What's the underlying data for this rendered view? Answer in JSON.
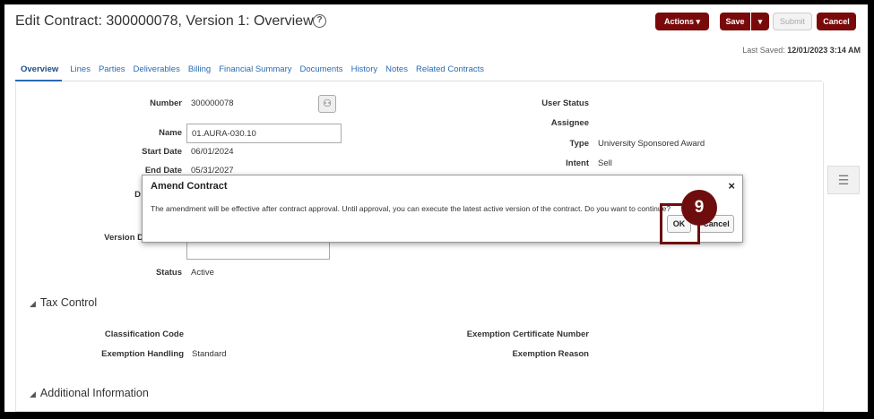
{
  "header": {
    "title": "Edit Contract: 300000078, Version 1: Overview",
    "help_icon": "?",
    "buttons": {
      "actions": "Actions ▾",
      "save": "Save",
      "save_menu": "▾",
      "submit": "Submit",
      "cancel": "Cancel"
    },
    "last_saved_label": "Last Saved:",
    "last_saved_value": "12/01/2023 3:14 AM"
  },
  "tabs": [
    "Overview",
    "Lines",
    "Parties",
    "Deliverables",
    "Billing",
    "Financial Summary",
    "Documents",
    "History",
    "Notes",
    "Related Contracts"
  ],
  "overview": {
    "number_label": "Number",
    "number_value": "300000078",
    "name_label": "Name",
    "name_value": "01.AURA-030.10",
    "start_date_label": "Start Date",
    "start_date_value": "06/01/2024",
    "end_date_label": "End Date",
    "end_date_value": "05/31/2027",
    "d_label_fragment": "D",
    "version_label_fragment": "Version D",
    "status_label": "Status",
    "status_value": "Active",
    "user_status_label": "User Status",
    "assignee_label": "Assignee",
    "type_label": "Type",
    "type_value": "University Sponsored Award",
    "intent_label": "Intent",
    "intent_value": "Sell"
  },
  "tax_control": {
    "heading": "Tax Control",
    "classification_code_label": "Classification Code",
    "exemption_handling_label": "Exemption Handling",
    "exemption_handling_value": "Standard",
    "exemption_cert_label": "Exemption Certificate Number",
    "exemption_reason_label": "Exemption Reason"
  },
  "additional_info": {
    "heading": "Additional Information"
  },
  "dialog": {
    "title": "Amend Contract",
    "close": "×",
    "message": "The amendment will be effective after contract approval. Until approval, you can execute the latest active version of the contract. Do you want to continue?",
    "ok": "OK",
    "cancel": "Cancel"
  },
  "callout": {
    "step": "9"
  },
  "colors": {
    "brand_dark_red": "#7a0a0a",
    "link_blue": "#2a6bb3",
    "callout": "#6e0d0d"
  }
}
